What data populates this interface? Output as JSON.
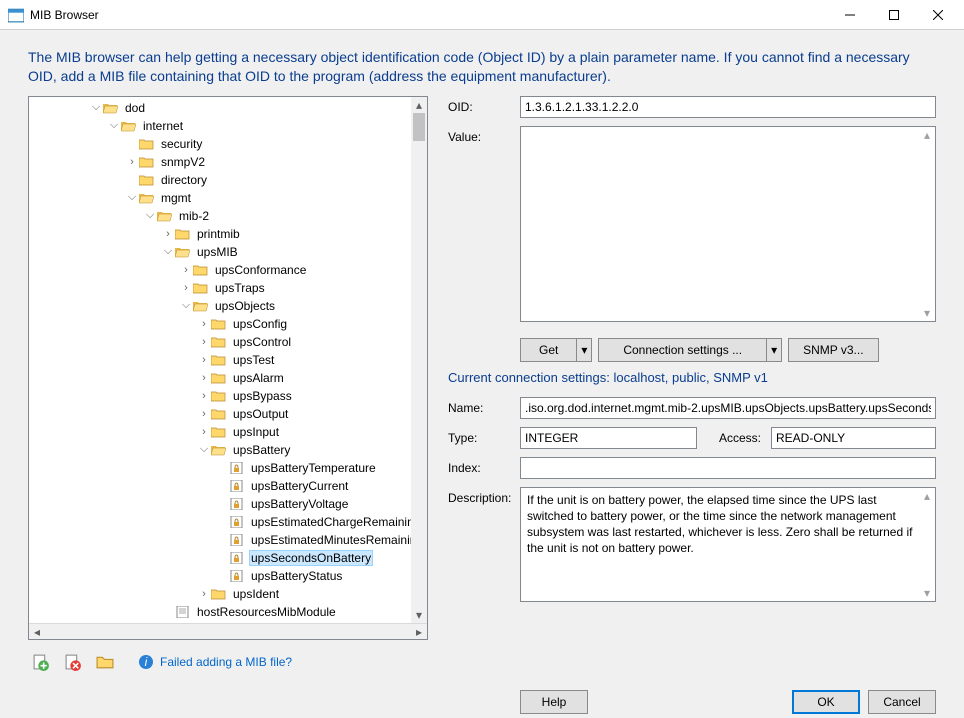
{
  "window": {
    "title": "MIB Browser"
  },
  "intro": "The MIB browser can help getting a necessary object identification code (Object ID) by a plain parameter name. If you cannot find a necessary OID, add a MIB file containing that OID to the program (address the equipment manufacturer).",
  "tree": {
    "root": "dod",
    "internet": "internet",
    "security": "security",
    "snmpV2": "snmpV2",
    "directory": "directory",
    "mgmt": "mgmt",
    "mib2": "mib-2",
    "printmib": "printmib",
    "upsMIB": "upsMIB",
    "upsConformance": "upsConformance",
    "upsTraps": "upsTraps",
    "upsObjects": "upsObjects",
    "upsConfig": "upsConfig",
    "upsControl": "upsControl",
    "upsTest": "upsTest",
    "upsAlarm": "upsAlarm",
    "upsBypass": "upsBypass",
    "upsOutput": "upsOutput",
    "upsInput": "upsInput",
    "upsBattery": "upsBattery",
    "upsBatteryTemperature": "upsBatteryTemperature",
    "upsBatteryCurrent": "upsBatteryCurrent",
    "upsBatteryVoltage": "upsBatteryVoltage",
    "upsEstimatedChargeRemaining": "upsEstimatedChargeRemainin",
    "upsEstimatedMinutesRemaining": "upsEstimatedMinutesRemainir",
    "upsSecondsOnBattery": "upsSecondsOnBattery",
    "upsBatteryStatus": "upsBatteryStatus",
    "upsIdent": "upsIdent",
    "hostResourcesMibModule": "hostResourcesMibModule"
  },
  "form": {
    "oid_label": "OID:",
    "oid_value": "1.3.6.1.2.1.33.1.2.2.0",
    "value_label": "Value:",
    "get_label": "Get",
    "conn_label": "Connection settings ...",
    "snmp_label": "SNMP v3...",
    "conn_line": "Current connection settings: localhost, public, SNMP v1",
    "name_label": "Name:",
    "name_value": ".iso.org.dod.internet.mgmt.mib-2.upsMIB.upsObjects.upsBattery.upsSecondsO",
    "type_label": "Type:",
    "type_value": "INTEGER",
    "access_label": "Access:",
    "access_value": "READ-ONLY",
    "index_label": "Index:",
    "index_value": "",
    "descr_label": "Description:",
    "descr_value": "If the unit is on battery power, the elapsed time since the UPS last switched to battery power, or the time since the network management subsystem was last restarted, whichever is less.  Zero shall be returned if the unit is not on battery power."
  },
  "toolbar": {
    "helpadd": "Failed adding a MIB file?"
  },
  "buttons": {
    "help": "Help",
    "ok": "OK",
    "cancel": "Cancel"
  }
}
